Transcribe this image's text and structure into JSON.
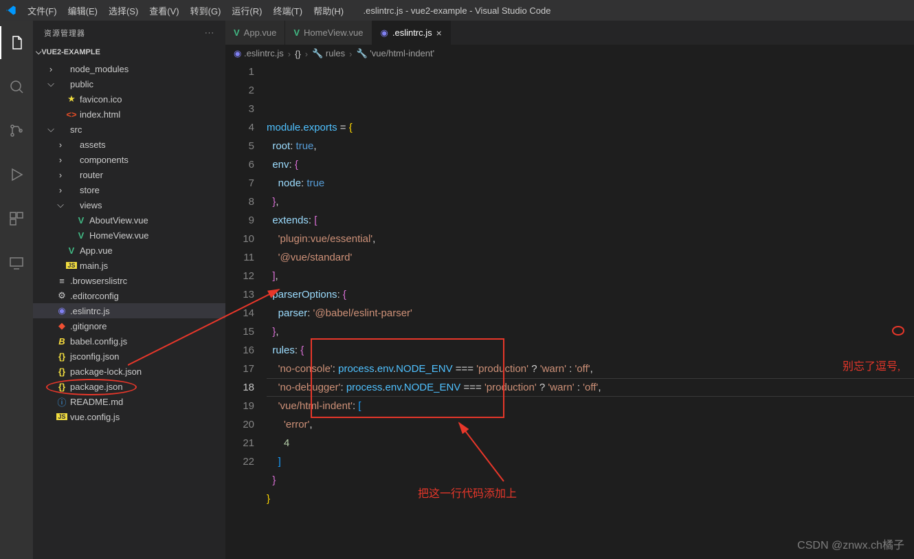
{
  "window_title": ".eslintrc.js - vue2-example - Visual Studio Code",
  "menu": [
    "文件(F)",
    "编辑(E)",
    "选择(S)",
    "查看(V)",
    "转到(G)",
    "运行(R)",
    "终端(T)",
    "帮助(H)"
  ],
  "sidebar_title": "资源管理器",
  "project_name": "VUE2-EXAMPLE",
  "tree": [
    {
      "indent": 1,
      "twist": ">",
      "icon": "folder",
      "label": "node_modules",
      "color": "#ccc"
    },
    {
      "indent": 1,
      "twist": "v",
      "icon": "folder",
      "label": "public",
      "color": "#ccc"
    },
    {
      "indent": 2,
      "twist": "",
      "icon": "star",
      "label": "favicon.ico",
      "color": "#ccc"
    },
    {
      "indent": 2,
      "twist": "",
      "icon": "html",
      "label": "index.html",
      "color": "#ccc"
    },
    {
      "indent": 1,
      "twist": "v",
      "icon": "folder",
      "label": "src",
      "color": "#ccc"
    },
    {
      "indent": 2,
      "twist": ">",
      "icon": "folder",
      "label": "assets",
      "color": "#ccc"
    },
    {
      "indent": 2,
      "twist": ">",
      "icon": "folder",
      "label": "components",
      "color": "#ccc"
    },
    {
      "indent": 2,
      "twist": ">",
      "icon": "folder",
      "label": "router",
      "color": "#ccc"
    },
    {
      "indent": 2,
      "twist": ">",
      "icon": "folder",
      "label": "store",
      "color": "#ccc"
    },
    {
      "indent": 2,
      "twist": "v",
      "icon": "folder",
      "label": "views",
      "color": "#ccc"
    },
    {
      "indent": 3,
      "twist": "",
      "icon": "vue",
      "label": "AboutView.vue",
      "color": "#ccc"
    },
    {
      "indent": 3,
      "twist": "",
      "icon": "vue",
      "label": "HomeView.vue",
      "color": "#ccc"
    },
    {
      "indent": 2,
      "twist": "",
      "icon": "vue",
      "label": "App.vue",
      "color": "#ccc"
    },
    {
      "indent": 2,
      "twist": "",
      "icon": "js",
      "label": "main.js",
      "color": "#ccc"
    },
    {
      "indent": 1,
      "twist": "",
      "icon": "file",
      "label": ".browserslistrc",
      "color": "#ccc"
    },
    {
      "indent": 1,
      "twist": "",
      "icon": "gear",
      "label": ".editorconfig",
      "color": "#ccc"
    },
    {
      "indent": 1,
      "twist": "",
      "icon": "eslint",
      "label": ".eslintrc.js",
      "color": "#ccc",
      "selected": true
    },
    {
      "indent": 1,
      "twist": "",
      "icon": "git",
      "label": ".gitignore",
      "color": "#ccc"
    },
    {
      "indent": 1,
      "twist": "",
      "icon": "babel",
      "label": "babel.config.js",
      "color": "#ccc"
    },
    {
      "indent": 1,
      "twist": "",
      "icon": "json",
      "label": "jsconfig.json",
      "color": "#ccc"
    },
    {
      "indent": 1,
      "twist": "",
      "icon": "json",
      "label": "package-lock.json",
      "color": "#ccc"
    },
    {
      "indent": 1,
      "twist": "",
      "icon": "json",
      "label": "package.json",
      "color": "#ccc"
    },
    {
      "indent": 1,
      "twist": "",
      "icon": "info",
      "label": "README.md",
      "color": "#ccc"
    },
    {
      "indent": 1,
      "twist": "",
      "icon": "js",
      "label": "vue.config.js",
      "color": "#ccc"
    }
  ],
  "tabs": [
    {
      "icon": "vue",
      "label": "App.vue",
      "active": false
    },
    {
      "icon": "vue",
      "label": "HomeView.vue",
      "active": false
    },
    {
      "icon": "eslint",
      "label": ".eslintrc.js",
      "active": true,
      "close": true
    }
  ],
  "breadcrumb": [
    {
      "icon": "eslint",
      "text": ".eslintrc.js"
    },
    {
      "icon": "brace",
      "text": "<unknown>"
    },
    {
      "icon": "wrench",
      "text": "rules"
    },
    {
      "icon": "wrench",
      "text": "'vue/html-indent'"
    }
  ],
  "line_numbers": [
    "1",
    "2",
    "3",
    "4",
    "5",
    "6",
    "7",
    "8",
    "9",
    "10",
    "11",
    "12",
    "13",
    "14",
    "15",
    "16",
    "17",
    "18",
    "19",
    "20",
    "21",
    "22"
  ],
  "current_line": 18,
  "code_lines": [
    [
      [
        "module",
        "var"
      ],
      [
        ".",
        "pun"
      ],
      [
        "exports",
        "var"
      ],
      [
        " ",
        "pun"
      ],
      [
        "=",
        "op"
      ],
      [
        " ",
        "pun"
      ],
      [
        "{",
        "br"
      ]
    ],
    [
      [
        "  ",
        "pun"
      ],
      [
        "root",
        "key"
      ],
      [
        ":",
        "pun"
      ],
      [
        " ",
        "pun"
      ],
      [
        "true",
        "kw"
      ],
      [
        ",",
        "pun"
      ]
    ],
    [
      [
        "  ",
        "pun"
      ],
      [
        "env",
        "key"
      ],
      [
        ":",
        "pun"
      ],
      [
        " ",
        "pun"
      ],
      [
        "{",
        "br2"
      ]
    ],
    [
      [
        "    ",
        "pun"
      ],
      [
        "node",
        "key"
      ],
      [
        ":",
        "pun"
      ],
      [
        " ",
        "pun"
      ],
      [
        "true",
        "kw"
      ]
    ],
    [
      [
        "  ",
        "pun"
      ],
      [
        "}",
        "br2"
      ],
      [
        ",",
        "pun"
      ]
    ],
    [
      [
        "  ",
        "pun"
      ],
      [
        "extends",
        "key"
      ],
      [
        ":",
        "pun"
      ],
      [
        " ",
        "pun"
      ],
      [
        "[",
        "br2"
      ]
    ],
    [
      [
        "    ",
        "pun"
      ],
      [
        "'plugin:vue/essential'",
        "str"
      ],
      [
        ",",
        "pun"
      ]
    ],
    [
      [
        "    ",
        "pun"
      ],
      [
        "'@vue/standard'",
        "str"
      ]
    ],
    [
      [
        "  ",
        "pun"
      ],
      [
        "]",
        "br2"
      ],
      [
        ",",
        "pun"
      ]
    ],
    [
      [
        "  ",
        "pun"
      ],
      [
        "parserOptions",
        "key"
      ],
      [
        ":",
        "pun"
      ],
      [
        " ",
        "pun"
      ],
      [
        "{",
        "br2"
      ]
    ],
    [
      [
        "    ",
        "pun"
      ],
      [
        "parser",
        "key"
      ],
      [
        ":",
        "pun"
      ],
      [
        " ",
        "pun"
      ],
      [
        "'@babel/eslint-parser'",
        "str"
      ]
    ],
    [
      [
        "  ",
        "pun"
      ],
      [
        "}",
        "br2"
      ],
      [
        ",",
        "pun"
      ]
    ],
    [
      [
        "  ",
        "pun"
      ],
      [
        "rules",
        "key"
      ],
      [
        ":",
        "pun"
      ],
      [
        " ",
        "pun"
      ],
      [
        "{",
        "br2"
      ]
    ],
    [
      [
        "    ",
        "pun"
      ],
      [
        "'no-console'",
        "str"
      ],
      [
        ":",
        "pun"
      ],
      [
        " ",
        "pun"
      ],
      [
        "process",
        "var"
      ],
      [
        ".",
        "pun"
      ],
      [
        "env",
        "var"
      ],
      [
        ".",
        "pun"
      ],
      [
        "NODE_ENV",
        "const"
      ],
      [
        " ",
        "pun"
      ],
      [
        "===",
        "op"
      ],
      [
        " ",
        "pun"
      ],
      [
        "'production'",
        "str"
      ],
      [
        " ",
        "pun"
      ],
      [
        "?",
        "op"
      ],
      [
        " ",
        "pun"
      ],
      [
        "'warn'",
        "str"
      ],
      [
        " ",
        "pun"
      ],
      [
        ":",
        "op"
      ],
      [
        " ",
        "pun"
      ],
      [
        "'off'",
        "str"
      ],
      [
        ",",
        "pun"
      ]
    ],
    [
      [
        "    ",
        "pun"
      ],
      [
        "'no-debugger'",
        "str"
      ],
      [
        ":",
        "pun"
      ],
      [
        " ",
        "pun"
      ],
      [
        "process",
        "var"
      ],
      [
        ".",
        "pun"
      ],
      [
        "env",
        "var"
      ],
      [
        ".",
        "pun"
      ],
      [
        "NODE_ENV",
        "const"
      ],
      [
        " ",
        "pun"
      ],
      [
        "===",
        "op"
      ],
      [
        " ",
        "pun"
      ],
      [
        "'production'",
        "str"
      ],
      [
        " ",
        "pun"
      ],
      [
        "?",
        "op"
      ],
      [
        " ",
        "pun"
      ],
      [
        "'warn'",
        "str"
      ],
      [
        " ",
        "pun"
      ],
      [
        ":",
        "op"
      ],
      [
        " ",
        "pun"
      ],
      [
        "'off'",
        "str"
      ],
      [
        ",",
        "pun"
      ]
    ],
    [
      [
        "    ",
        "pun"
      ],
      [
        "'vue/html-indent'",
        "str"
      ],
      [
        ":",
        "pun"
      ],
      [
        " ",
        "pun"
      ],
      [
        "[",
        "br3"
      ]
    ],
    [
      [
        "      ",
        "pun"
      ],
      [
        "'error'",
        "str"
      ],
      [
        ",",
        "pun"
      ]
    ],
    [
      [
        "      ",
        "pun"
      ],
      [
        "4",
        "num"
      ]
    ],
    [
      [
        "    ",
        "pun"
      ],
      [
        "]",
        "br3"
      ]
    ],
    [
      [
        "  ",
        "pun"
      ],
      [
        "}",
        "br2"
      ]
    ],
    [
      [
        "}",
        "br"
      ]
    ],
    [
      [
        "",
        "pun"
      ]
    ]
  ],
  "annotations": {
    "comma_hint": "别忘了逗号,",
    "add_line_hint": "把这一行代码添加上"
  },
  "watermark": "CSDN @znwx.ch橘子"
}
